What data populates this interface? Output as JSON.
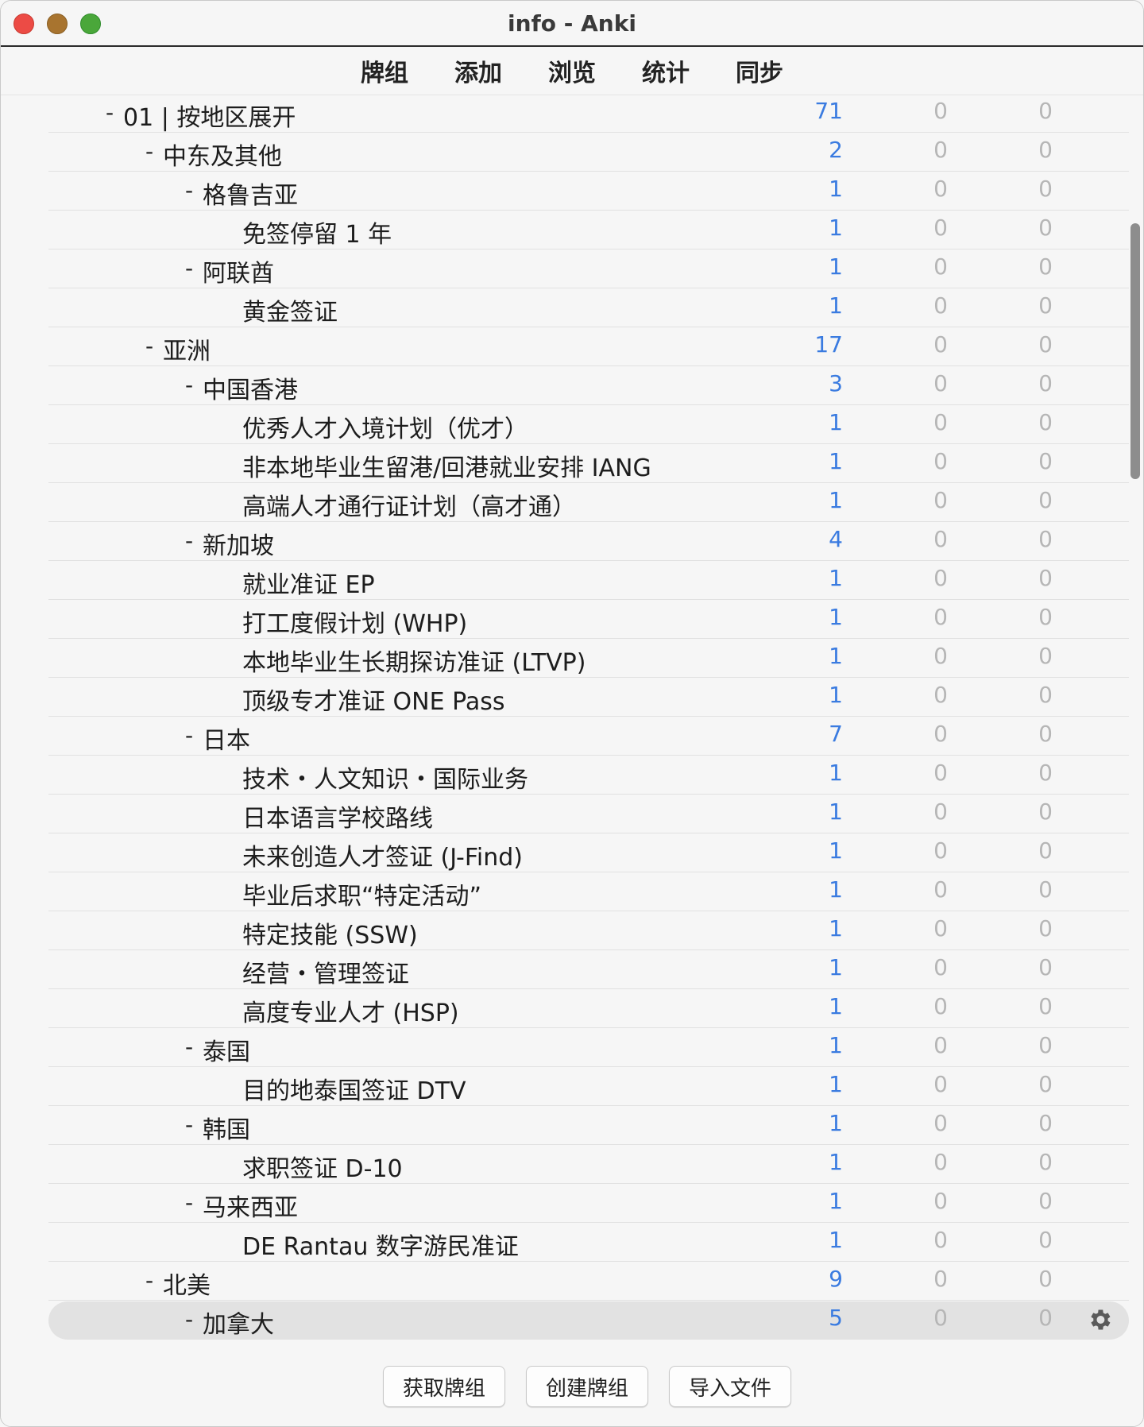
{
  "window": {
    "title": "info - Anki"
  },
  "toolbar": {
    "decks": "牌组",
    "add": "添加",
    "browse": "浏览",
    "stats": "统计",
    "sync": "同步"
  },
  "decks": [
    {
      "name": "01 | 按地区展开",
      "level": 0,
      "toggle": "-",
      "new": "71",
      "learn": "0",
      "due": "0"
    },
    {
      "name": "中东及其他",
      "level": 1,
      "toggle": "-",
      "new": "2",
      "learn": "0",
      "due": "0"
    },
    {
      "name": "格鲁吉亚",
      "level": 2,
      "toggle": "-",
      "new": "1",
      "learn": "0",
      "due": "0"
    },
    {
      "name": "免签停留 1 年",
      "level": 3,
      "toggle": "",
      "new": "1",
      "learn": "0",
      "due": "0"
    },
    {
      "name": "阿联酋",
      "level": 2,
      "toggle": "-",
      "new": "1",
      "learn": "0",
      "due": "0"
    },
    {
      "name": "黄金签证",
      "level": 3,
      "toggle": "",
      "new": "1",
      "learn": "0",
      "due": "0"
    },
    {
      "name": "亚洲",
      "level": 1,
      "toggle": "-",
      "new": "17",
      "learn": "0",
      "due": "0"
    },
    {
      "name": "中国香港",
      "level": 2,
      "toggle": "-",
      "new": "3",
      "learn": "0",
      "due": "0"
    },
    {
      "name": "优秀人才入境计划（优才）",
      "level": 3,
      "toggle": "",
      "new": "1",
      "learn": "0",
      "due": "0"
    },
    {
      "name": "非本地毕业生留港/回港就业安排 IANG",
      "level": 3,
      "toggle": "",
      "new": "1",
      "learn": "0",
      "due": "0"
    },
    {
      "name": "高端人才通行证计划（高才通）",
      "level": 3,
      "toggle": "",
      "new": "1",
      "learn": "0",
      "due": "0"
    },
    {
      "name": "新加坡",
      "level": 2,
      "toggle": "-",
      "new": "4",
      "learn": "0",
      "due": "0"
    },
    {
      "name": "就业准证 EP",
      "level": 3,
      "toggle": "",
      "new": "1",
      "learn": "0",
      "due": "0"
    },
    {
      "name": "打工度假计划 (WHP)",
      "level": 3,
      "toggle": "",
      "new": "1",
      "learn": "0",
      "due": "0"
    },
    {
      "name": "本地毕业生长期探访准证 (LTVP)",
      "level": 3,
      "toggle": "",
      "new": "1",
      "learn": "0",
      "due": "0"
    },
    {
      "name": "顶级专才准证 ONE Pass",
      "level": 3,
      "toggle": "",
      "new": "1",
      "learn": "0",
      "due": "0"
    },
    {
      "name": "日本",
      "level": 2,
      "toggle": "-",
      "new": "7",
      "learn": "0",
      "due": "0"
    },
    {
      "name": "技术・人文知识・国际业务",
      "level": 3,
      "toggle": "",
      "new": "1",
      "learn": "0",
      "due": "0"
    },
    {
      "name": "日本语言学校路线",
      "level": 3,
      "toggle": "",
      "new": "1",
      "learn": "0",
      "due": "0"
    },
    {
      "name": "未来创造人才签证 (J-Find)",
      "level": 3,
      "toggle": "",
      "new": "1",
      "learn": "0",
      "due": "0"
    },
    {
      "name": "毕业后求职“特定活动”",
      "level": 3,
      "toggle": "",
      "new": "1",
      "learn": "0",
      "due": "0"
    },
    {
      "name": "特定技能 (SSW)",
      "level": 3,
      "toggle": "",
      "new": "1",
      "learn": "0",
      "due": "0"
    },
    {
      "name": "经营・管理签证",
      "level": 3,
      "toggle": "",
      "new": "1",
      "learn": "0",
      "due": "0"
    },
    {
      "name": "高度专业人才 (HSP)",
      "level": 3,
      "toggle": "",
      "new": "1",
      "learn": "0",
      "due": "0"
    },
    {
      "name": "泰国",
      "level": 2,
      "toggle": "-",
      "new": "1",
      "learn": "0",
      "due": "0"
    },
    {
      "name": "目的地泰国签证 DTV",
      "level": 3,
      "toggle": "",
      "new": "1",
      "learn": "0",
      "due": "0"
    },
    {
      "name": "韩国",
      "level": 2,
      "toggle": "-",
      "new": "1",
      "learn": "0",
      "due": "0"
    },
    {
      "name": "求职签证 D-10",
      "level": 3,
      "toggle": "",
      "new": "1",
      "learn": "0",
      "due": "0"
    },
    {
      "name": "马来西亚",
      "level": 2,
      "toggle": "-",
      "new": "1",
      "learn": "0",
      "due": "0"
    },
    {
      "name": "DE Rantau 数字游民准证",
      "level": 3,
      "toggle": "",
      "new": "1",
      "learn": "0",
      "due": "0"
    },
    {
      "name": "北美",
      "level": 1,
      "toggle": "-",
      "new": "9",
      "learn": "0",
      "due": "0"
    },
    {
      "name": "加拿大",
      "level": 2,
      "toggle": "-",
      "new": "5",
      "learn": "0",
      "due": "0",
      "selected": true,
      "options_icon": "gear-icon"
    }
  ],
  "bottom": {
    "get_shared": "获取牌组",
    "create_deck": "创建牌组",
    "import_file": "导入文件"
  }
}
